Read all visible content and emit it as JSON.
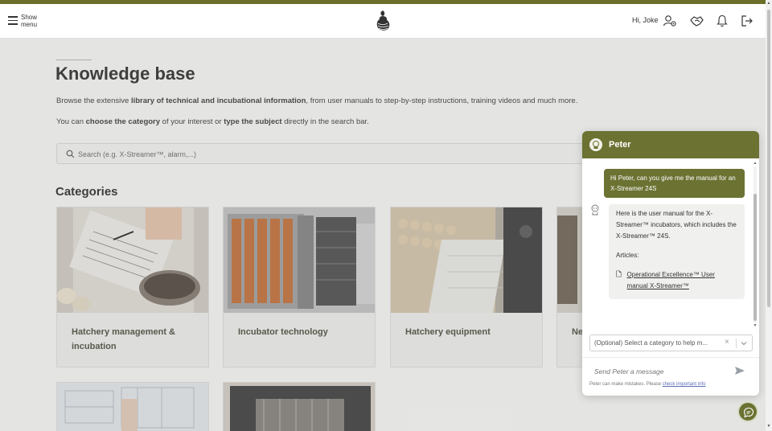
{
  "header": {
    "menu_label": "Show menu",
    "greeting": "Hi, Joke",
    "icons": [
      "menu-icon",
      "logo",
      "user-settings-icon",
      "handshake-icon",
      "bell-icon",
      "logout-icon"
    ]
  },
  "main": {
    "title": "Knowledge base",
    "intro_pre": "Browse the extensive ",
    "intro_bold": "library of technical and incubational information",
    "intro_post": ", from user manuals to step-by-step instructions, training videos and much more.",
    "intro2_pre": "You can ",
    "intro2_bold1": "choose the category",
    "intro2_mid": " of your interest or ",
    "intro2_bold2": "type the subject",
    "intro2_post": " directly in the search bar.",
    "search_placeholder": "Search (e.g. X-Streamer™, alarm,...)",
    "categories_title": "Categories",
    "categories": [
      {
        "label": "Hatchery management & incubation"
      },
      {
        "label": "Incubator technology"
      },
      {
        "label": "Hatchery equipment"
      },
      {
        "label": "Ne"
      }
    ]
  },
  "chat": {
    "name": "Peter",
    "user_message": "Hi Peter, can you give me the manual for an X-Streamer 24S",
    "bot_message": "Here is the user manual for the X-Streamer™ incubators, which includes the X-Streamer™ 24S.",
    "articles_label": "Articles:",
    "article_link": "Operational Excellence™ User manual X-Streamer™",
    "category_select": "(Optional) Select a category to help m...",
    "input_placeholder": "Send Peter a message",
    "disclaimer_pre": "Peter can make mistakes. Please ",
    "disclaimer_link": "check important info"
  },
  "colors": {
    "brand": "#6b7232",
    "top_stripe": "#6b6f2a"
  }
}
